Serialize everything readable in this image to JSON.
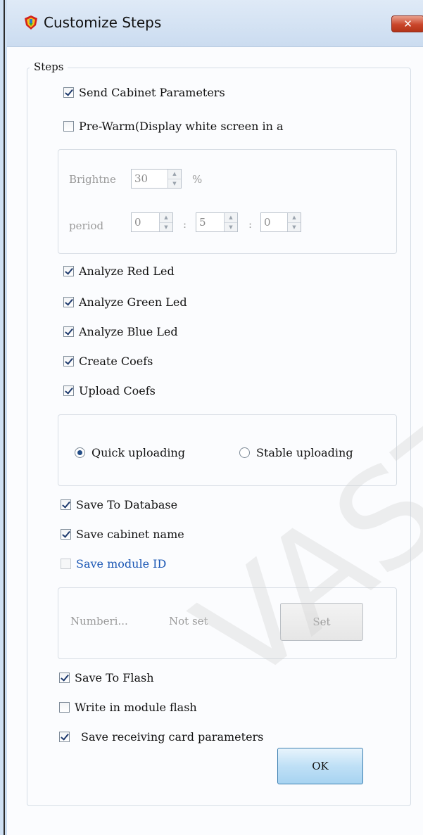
{
  "window": {
    "title": "Customize Steps",
    "close_label": "✕"
  },
  "group": {
    "title": "Steps"
  },
  "steps": {
    "send_cabinet_parameters": "Send Cabinet Parameters",
    "pre_warm": "Pre-Warm(Display white screen in a",
    "analyze_red": "Analyze Red Led",
    "analyze_green": "Analyze Green Led",
    "analyze_blue": "Analyze Blue Led",
    "create_coefs": "Create Coefs",
    "upload_coefs": "Upload Coefs",
    "save_to_database": "Save To Database",
    "save_cabinet_name": "Save cabinet name",
    "save_module_id": "Save module ID",
    "save_to_flash": "Save To Flash",
    "write_in_module_flash": "Write in module flash",
    "save_receiving_card_parameters": "Save receiving card parameters"
  },
  "prewarm": {
    "brightness_label": "Brightne",
    "brightness_value": "30",
    "percent_unit": "%",
    "period_label": "period",
    "hours": "0",
    "minutes": "5",
    "seconds": "0",
    "separator": ":"
  },
  "upload_mode": {
    "quick": "Quick uploading",
    "stable": "Stable uploading"
  },
  "numbering": {
    "label": "Numberi...",
    "value": "Not set",
    "set_button": "Set"
  },
  "buttons": {
    "ok": "OK"
  },
  "watermark": "VASTAR T"
}
